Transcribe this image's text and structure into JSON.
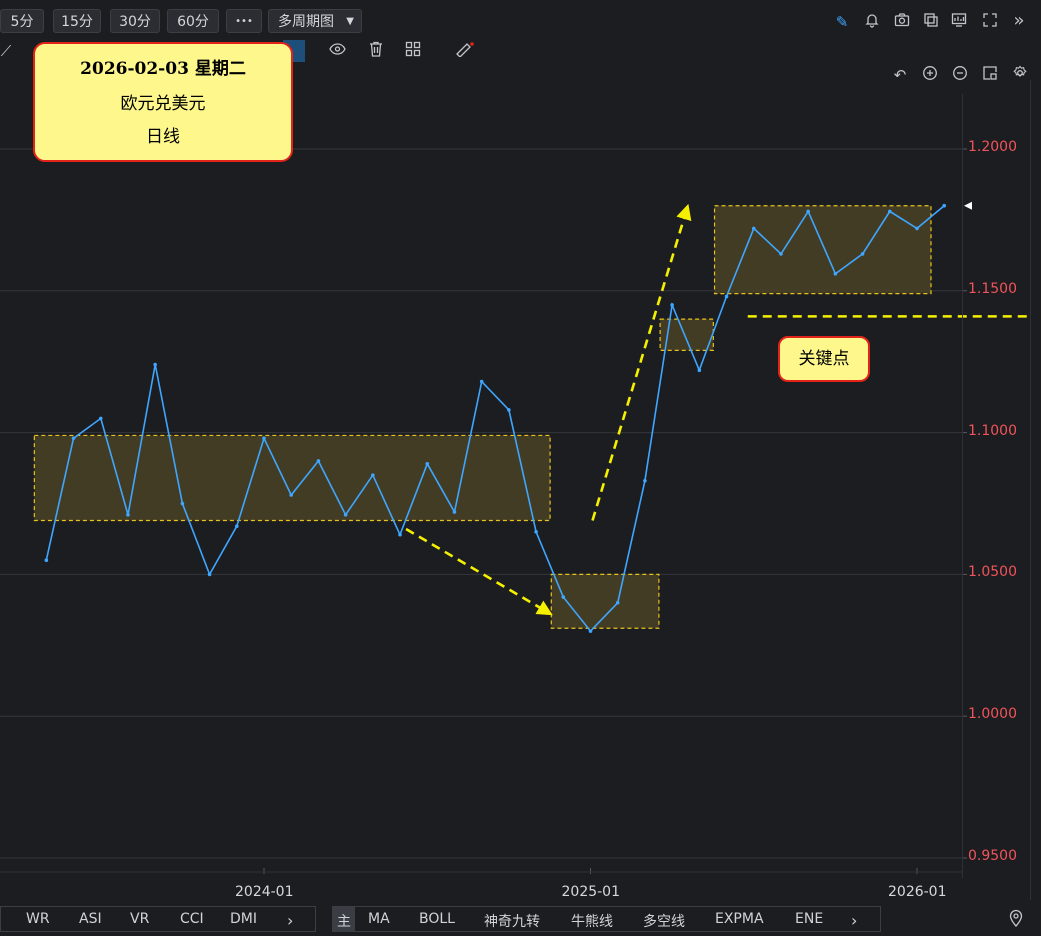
{
  "toolbar": {
    "periods": [
      "5分",
      "15分",
      "30分",
      "60分"
    ],
    "more_label": "•••",
    "multi_period": "多周期图"
  },
  "info_box": {
    "date_line": "2026-02-03 星期二",
    "pair": "欧元兑美元",
    "period": "日线"
  },
  "key_point_label": "关键点",
  "price_axis": [
    "1.2000",
    "1.1500",
    "1.1000",
    "1.0500",
    "1.0000",
    "0.9500"
  ],
  "date_axis": [
    "2024-01",
    "2025-01",
    "2026-01"
  ],
  "indicators_left": [
    "WR",
    "ASI",
    "VR",
    "CCI",
    "DMI"
  ],
  "indicators_main": [
    "主",
    "MA",
    "BOLL",
    "神奇九转",
    "牛熊线",
    "多空线",
    "EXPMA",
    "ENE"
  ],
  "colors": {
    "background": "#1c1d21",
    "line": "#3ea6ff",
    "price_text": "#f0545a",
    "zone_fill": "#4a4224",
    "zone_border": "#e8c21c",
    "annotation": "#f5f000"
  },
  "chart_data": {
    "type": "line",
    "title": "欧元兑美元 日线",
    "ylim": [
      0.95,
      1.2
    ],
    "x_ticks": [
      "2024-01",
      "2025-01",
      "2026-01"
    ],
    "y_ticks": [
      0.95,
      1.0,
      1.05,
      1.1,
      1.15,
      1.2
    ],
    "series": [
      {
        "name": "欧元兑美元",
        "x": [
          "2023-05",
          "2023-06",
          "2023-07",
          "2023-08",
          "2023-09",
          "2023-10",
          "2023-11",
          "2023-12",
          "2024-01",
          "2024-02",
          "2024-03",
          "2024-04",
          "2024-05",
          "2024-06",
          "2024-07",
          "2024-08",
          "2024-09",
          "2024-10",
          "2024-11",
          "2024-12",
          "2025-01",
          "2025-02",
          "2025-03",
          "2025-04",
          "2025-05",
          "2025-06",
          "2025-07",
          "2025-08",
          "2025-09",
          "2025-10",
          "2025-11",
          "2025-12",
          "2026-01",
          "2026-02"
        ],
        "values": [
          1.055,
          1.098,
          1.105,
          1.071,
          1.124,
          1.075,
          1.05,
          1.067,
          1.098,
          1.078,
          1.09,
          1.071,
          1.085,
          1.064,
          1.089,
          1.072,
          1.118,
          1.108,
          1.065,
          1.042,
          1.03,
          1.04,
          1.083,
          1.145,
          1.122,
          1.148,
          1.172,
          1.163,
          1.178,
          1.156,
          1.163,
          1.178,
          1.172,
          1.18
        ]
      }
    ],
    "zones": [
      {
        "from": "2023-05",
        "to": "2024-11",
        "low": 1.069,
        "high": 1.099
      },
      {
        "from": "2024-12",
        "to": "2025-03",
        "low": 1.031,
        "high": 1.05
      },
      {
        "from": "2025-04",
        "to": "2025-05",
        "low": 1.129,
        "high": 1.14
      },
      {
        "from": "2025-06",
        "to": "2026-01",
        "low": 1.149,
        "high": 1.18
      }
    ],
    "key_level": 1.141,
    "current_marker": 1.18
  }
}
